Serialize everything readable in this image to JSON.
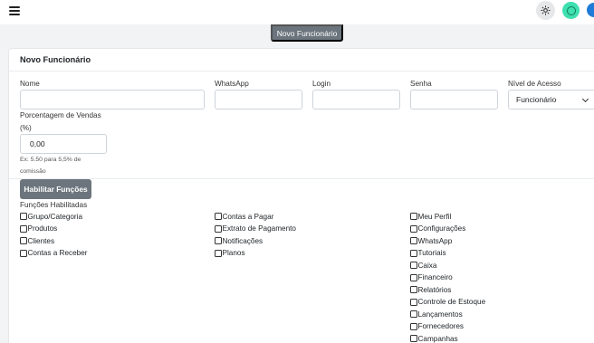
{
  "topbar": {
    "menu_icon": "hamburger-icon",
    "theme_icon": "sun-icon",
    "support_icon": "support-icon"
  },
  "top_button": "Novo Funcionário",
  "card": {
    "title": "Novo Funcionário"
  },
  "form": {
    "nome": {
      "label": "Nome",
      "value": ""
    },
    "whatsapp": {
      "label": "WhatsApp",
      "value": ""
    },
    "login": {
      "label": "Login",
      "value": ""
    },
    "senha": {
      "label": "Senha",
      "value": ""
    },
    "nivel": {
      "label": "Nível de Acesso",
      "value": "Funcionário"
    },
    "porcentagem": {
      "label_line1": "Porcentagem de Vendas",
      "label_line2": "(%)",
      "value": "0,00",
      "hint_line1": "Ex: 5.50 para 5,5% de",
      "hint_line2": "comissão"
    }
  },
  "habilitar_button": "Habilitar Funções",
  "funcoes_title": "Funções Habilitadas",
  "functions": {
    "col1": [
      "Grupo/Categoria",
      "Produtos",
      "Clientes",
      "Contas a Receber"
    ],
    "col2": [
      "Contas a Pagar",
      "Extrato de Pagamento",
      "Notificações",
      "Planos"
    ],
    "col3": [
      "Meu Perfil",
      "Configurações",
      "WhatsApp",
      "Tutoriais",
      "Caixa",
      "Financeiro",
      "Relatórios",
      "Controle de Estoque",
      "Lançamentos",
      "Fornecedores",
      "Campanhas"
    ]
  }
}
